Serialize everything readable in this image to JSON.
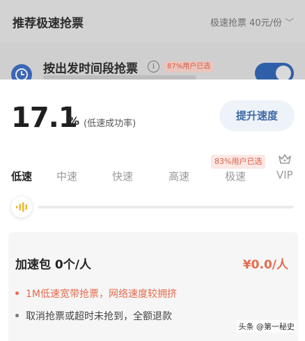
{
  "background": {
    "title": "推荐极速抢票",
    "price": "极速抢票 40元/份",
    "chevron": "﹀",
    "row_title": "按出发时间段抢票",
    "info_glyph": "i",
    "badge": "87%用户已选"
  },
  "sheet": {
    "rate_value": "17.1",
    "rate_percent": "%",
    "rate_label": "(低速成功率)",
    "upgrade_button": "提升速度",
    "popular_badge": "83%用户已选",
    "tabs": [
      {
        "label": "低速"
      },
      {
        "label": "中速"
      },
      {
        "label": "快速"
      },
      {
        "label": "高速"
      },
      {
        "label": "极速"
      },
      {
        "label": "VIP"
      }
    ],
    "slider_level": 0
  },
  "pack": {
    "title": "加速包 0个/人",
    "price": "¥0.0/人",
    "bullets": [
      "1M低速宽带抢票，网络速度较拥挤",
      "取消抢票或超时未抢到，全额退款"
    ]
  },
  "watermark": "头条 @第一秘史",
  "colors": {
    "accent_blue": "#3e6aa7",
    "accent_orange": "#e56a4c",
    "knob_yellow": "#f1b327"
  }
}
